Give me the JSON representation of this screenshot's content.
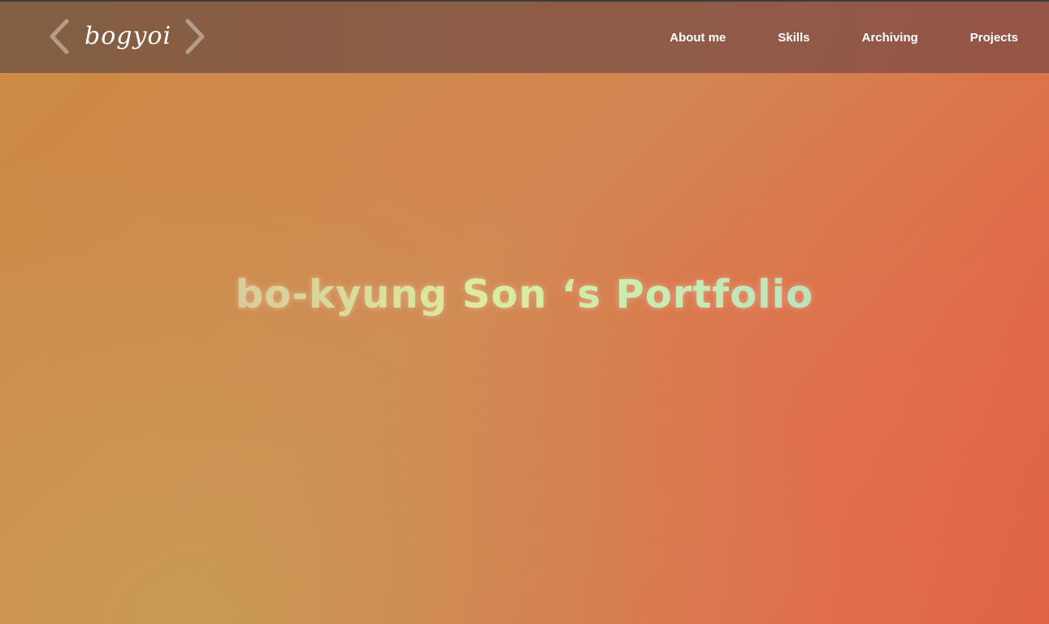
{
  "header": {
    "brand": "bogyoi",
    "nav": [
      {
        "label": "About me"
      },
      {
        "label": "Skills"
      },
      {
        "label": "Archiving"
      },
      {
        "label": "Projects"
      }
    ]
  },
  "hero": {
    "title": "bo-kyung Son ‘s Portfolio"
  },
  "icons": {
    "brand_left": "chevron-left-icon",
    "brand_right": "chevron-right-icon"
  },
  "colors": {
    "nav_background": "#7d5a48",
    "nav_text": "#ffffff",
    "gradient_start": "#cd8a45",
    "gradient_end": "#e0583d",
    "title_gradient_start": "#d8c3a8",
    "title_gradient_end": "#98c8ce"
  }
}
